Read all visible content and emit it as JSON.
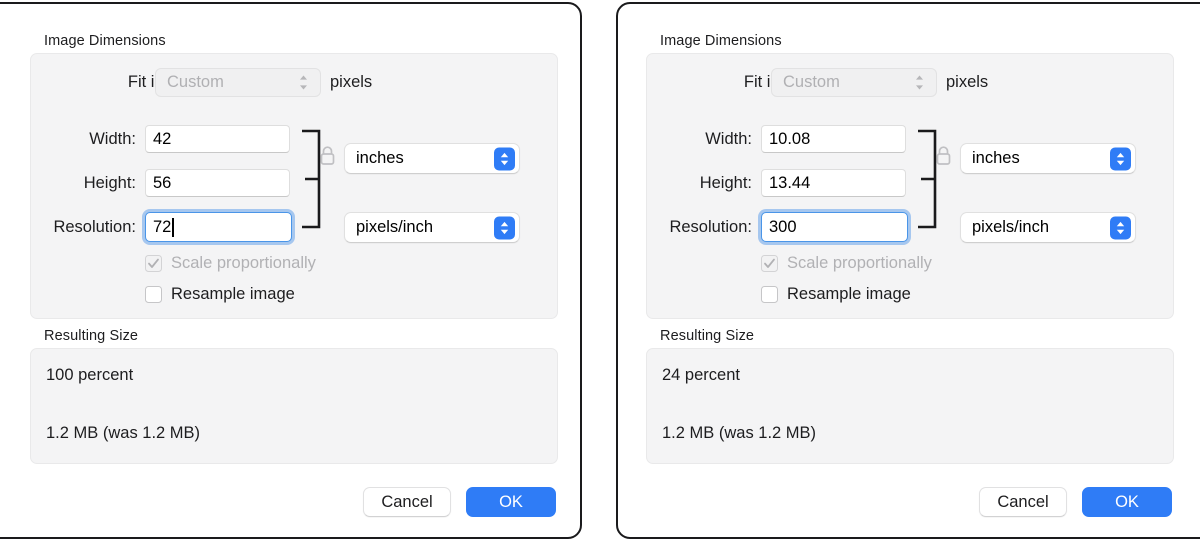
{
  "dialogs": [
    {
      "id": "left",
      "group": {
        "caption": "Image Dimensions",
        "fit_into": {
          "label": "Fit into:",
          "value": "Custom",
          "unit_suffix": "pixels"
        },
        "fields": [
          {
            "label": "Width:",
            "value": "42",
            "focused": false
          },
          {
            "label": "Height:",
            "value": "56",
            "focused": false
          },
          {
            "label": "Resolution:",
            "value": "72",
            "focused": true
          }
        ],
        "unit_popups": [
          {
            "value": "inches"
          },
          {
            "value": "pixels/inch"
          }
        ],
        "checkboxes": [
          {
            "label": "Scale proportionally",
            "checked": true,
            "enabled": false
          },
          {
            "label": "Resample image",
            "checked": false,
            "enabled": true
          }
        ]
      },
      "result": {
        "caption": "Resulting Size",
        "percent": "100 percent",
        "size": "1.2 MB (was 1.2 MB)"
      },
      "buttons": {
        "cancel": "Cancel",
        "ok": "OK"
      }
    },
    {
      "id": "right",
      "group": {
        "caption": "Image Dimensions",
        "fit_into": {
          "label": "Fit into:",
          "value": "Custom",
          "unit_suffix": "pixels"
        },
        "fields": [
          {
            "label": "Width:",
            "value": "10.08",
            "focused": false
          },
          {
            "label": "Height:",
            "value": "13.44",
            "focused": false
          },
          {
            "label": "Resolution:",
            "value": "300",
            "focused": true
          }
        ],
        "unit_popups": [
          {
            "value": "inches"
          },
          {
            "value": "pixels/inch"
          }
        ],
        "checkboxes": [
          {
            "label": "Scale proportionally",
            "checked": true,
            "enabled": false
          },
          {
            "label": "Resample image",
            "checked": false,
            "enabled": true
          }
        ]
      },
      "result": {
        "caption": "Resulting Size",
        "percent": "24 percent",
        "size": "1.2 MB (was 1.2 MB)"
      },
      "buttons": {
        "cancel": "Cancel",
        "ok": "OK"
      }
    }
  ],
  "colors": {
    "accent": "#2f7cf6",
    "dialog_border": "#1a1a1c",
    "group_bg": "#f4f4f5",
    "disabled_text": "#b0b0b3",
    "text": "#1d1d1f"
  },
  "icons": {
    "lock": "lock-icon",
    "chevron_up_down": "chevron-up-down-icon",
    "checkmark": "checkmark-icon",
    "link_bracket": "link-bracket-icon"
  }
}
